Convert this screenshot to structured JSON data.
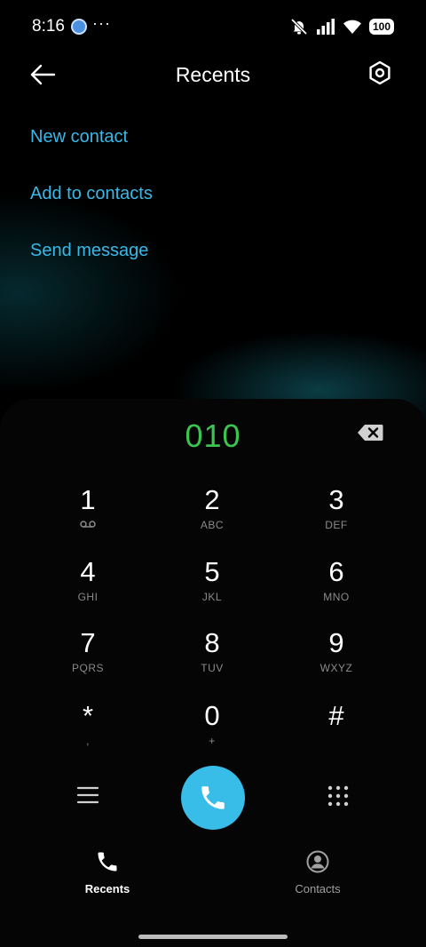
{
  "status_bar": {
    "time": "8:16",
    "more": "···",
    "battery": "100"
  },
  "header": {
    "title": "Recents"
  },
  "actions": {
    "new_contact": "New contact",
    "add_to_contacts": "Add to contacts",
    "send_message": "Send message"
  },
  "dialer": {
    "number": "010",
    "keys": [
      {
        "digit": "1",
        "letters": ""
      },
      {
        "digit": "2",
        "letters": "ABC"
      },
      {
        "digit": "3",
        "letters": "DEF"
      },
      {
        "digit": "4",
        "letters": "GHI"
      },
      {
        "digit": "5",
        "letters": "JKL"
      },
      {
        "digit": "6",
        "letters": "MNO"
      },
      {
        "digit": "7",
        "letters": "PQRS"
      },
      {
        "digit": "8",
        "letters": "TUV"
      },
      {
        "digit": "9",
        "letters": "WXYZ"
      },
      {
        "digit": "*",
        "letters": ","
      },
      {
        "digit": "0",
        "letters": "+"
      },
      {
        "digit": "#",
        "letters": ""
      }
    ]
  },
  "bottom_nav": {
    "recents": "Recents",
    "contacts": "Contacts"
  },
  "colors": {
    "accent": "#3ab8e8",
    "number_green": "#3cc450",
    "call_button": "#38bde8"
  },
  "icons": {
    "voicemail": "voicemail-icon",
    "back": "back-arrow-icon",
    "settings": "settings-hexagon-icon",
    "backspace": "backspace-icon",
    "call": "phone-icon",
    "menu": "menu-icon",
    "dialpad": "dialpad-icon"
  }
}
